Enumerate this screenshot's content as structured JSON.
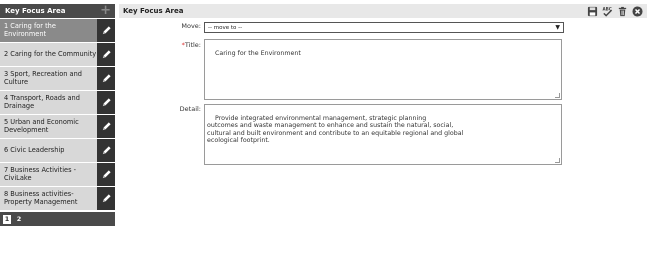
{
  "left": {
    "title": "Key Focus Area",
    "items": [
      {
        "label": "1 Caring for the Environment"
      },
      {
        "label": "2 Caring for the Community"
      },
      {
        "label": "3 Sport, Recreation and Culture"
      },
      {
        "label": "4 Transport, Roads and Drainage"
      },
      {
        "label": "5 Urban and Economic Development"
      },
      {
        "label": "6 Civic Leadership"
      },
      {
        "label": "7 Business Activities - CiviLake"
      },
      {
        "label": "8 Business activities- Property Management"
      }
    ],
    "pages": [
      "1",
      "2"
    ]
  },
  "right": {
    "title": "Key Focus Area",
    "move_label": "Move:",
    "move_value": "-- move to --",
    "title_label": "Title:",
    "title_required": "*",
    "title_value": "Caring for the Environment",
    "detail_label": "Detail:",
    "detail_value": "Provide integrated environmental management, strategic planning\noutcomes and waste management to enhance and sustain the natural, social,\ncultural and built environment and contribute to an equitable regional and global\necological footprint."
  },
  "icons": {
    "add": "plus-icon",
    "edit": "pencil-icon",
    "save": "save-icon",
    "spellcheck": "spellcheck-icon",
    "delete": "trash-icon",
    "close": "close-icon"
  }
}
